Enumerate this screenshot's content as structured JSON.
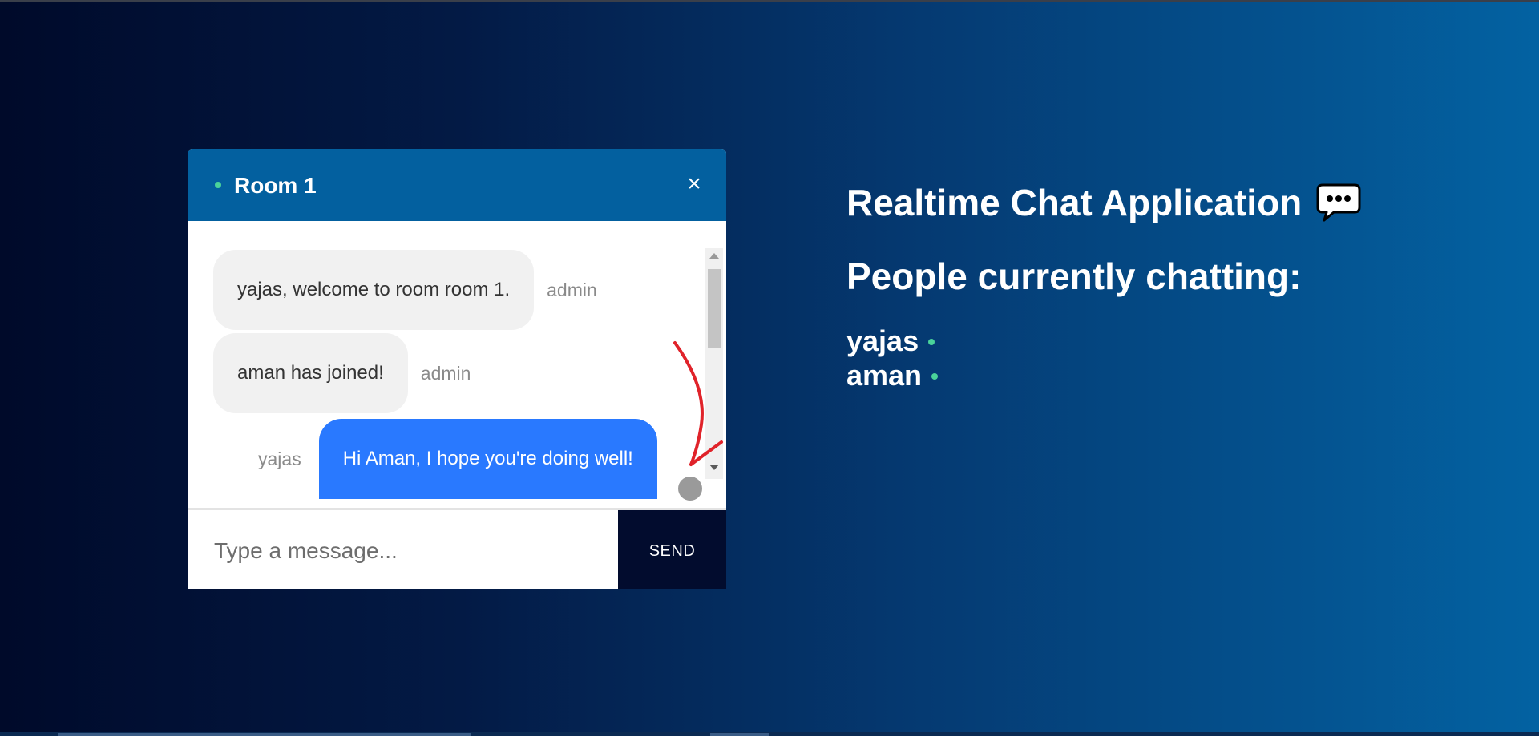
{
  "chat": {
    "room_title": "Room 1",
    "close_label": "×",
    "messages": [
      {
        "text": "yajas, welcome to room room 1.",
        "sender": "admin",
        "direction": "incoming"
      },
      {
        "text": "aman has joined!",
        "sender": "admin",
        "direction": "incoming"
      },
      {
        "text": "Hi Aman, I hope you're doing well!",
        "sender": "yajas",
        "direction": "outgoing"
      }
    ],
    "input_placeholder": "Type a message...",
    "send_label": "SEND"
  },
  "info": {
    "app_title": "Realtime Chat Application",
    "people_title": "People currently chatting:",
    "people": [
      "yajas",
      "aman"
    ]
  },
  "colors": {
    "header": "#03609f",
    "online_dot": "#4ad39a",
    "outgoing_bubble": "#2979ff",
    "incoming_bubble": "#f1f1f1",
    "send_button": "#020c2e",
    "annotation_arrow": "#e0232a"
  },
  "icons": {
    "chat_icon": "speech-bubble-ellipsis-icon",
    "close_icon": "close-icon"
  }
}
